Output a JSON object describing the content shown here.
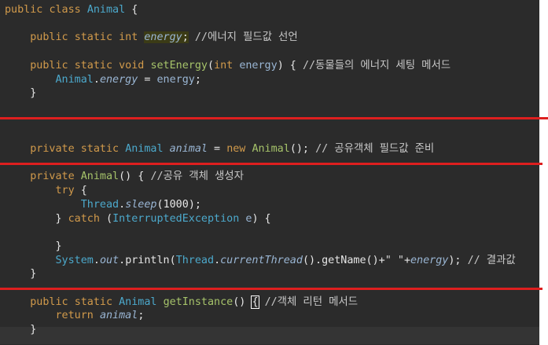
{
  "code_lines": [
    {
      "tokens": [
        {
          "c": "kw",
          "t": "public"
        },
        {
          "c": "pl",
          "t": " "
        },
        {
          "c": "kw",
          "t": "class"
        },
        {
          "c": "pl",
          "t": " "
        },
        {
          "c": "ty",
          "t": "Animal"
        },
        {
          "c": "pl",
          "t": " {"
        }
      ]
    },
    {
      "tokens": []
    },
    {
      "tokens": [
        {
          "c": "pl",
          "t": "    "
        },
        {
          "c": "kw",
          "t": "public"
        },
        {
          "c": "pl",
          "t": " "
        },
        {
          "c": "kw",
          "t": "static"
        },
        {
          "c": "pl",
          "t": " "
        },
        {
          "c": "kw",
          "t": "int"
        },
        {
          "c": "pl",
          "t": " "
        },
        {
          "c": "it hl",
          "t": "energy"
        },
        {
          "c": "pl hl",
          "t": ";"
        },
        {
          "c": "pl",
          "t": " "
        },
        {
          "c": "cm",
          "t": "//에너지 필드값 선언"
        }
      ]
    },
    {
      "tokens": []
    },
    {
      "tokens": [
        {
          "c": "pl",
          "t": "    "
        },
        {
          "c": "kw",
          "t": "public"
        },
        {
          "c": "pl",
          "t": " "
        },
        {
          "c": "kw",
          "t": "static"
        },
        {
          "c": "pl",
          "t": " "
        },
        {
          "c": "kw",
          "t": "void"
        },
        {
          "c": "pl",
          "t": " "
        },
        {
          "c": "fn",
          "t": "setEnergy"
        },
        {
          "c": "pl",
          "t": "("
        },
        {
          "c": "kw",
          "t": "int"
        },
        {
          "c": "pl",
          "t": " "
        },
        {
          "c": "var",
          "t": "energy"
        },
        {
          "c": "pl",
          "t": ") { "
        },
        {
          "c": "cm",
          "t": "//동물들의 에너지 세팅 메서드"
        }
      ]
    },
    {
      "tokens": [
        {
          "c": "pl",
          "t": "        "
        },
        {
          "c": "ty",
          "t": "Animal"
        },
        {
          "c": "pl",
          "t": "."
        },
        {
          "c": "it",
          "t": "energy"
        },
        {
          "c": "pl",
          "t": " = "
        },
        {
          "c": "var",
          "t": "energy"
        },
        {
          "c": "pl",
          "t": ";"
        }
      ]
    },
    {
      "tokens": [
        {
          "c": "pl",
          "t": "    }"
        }
      ]
    },
    {
      "tokens": []
    },
    {
      "tokens": []
    },
    {
      "tokens": []
    },
    {
      "tokens": [
        {
          "c": "pl",
          "t": "    "
        },
        {
          "c": "kw",
          "t": "private"
        },
        {
          "c": "pl",
          "t": " "
        },
        {
          "c": "kw",
          "t": "static"
        },
        {
          "c": "pl",
          "t": " "
        },
        {
          "c": "ty",
          "t": "Animal"
        },
        {
          "c": "pl",
          "t": " "
        },
        {
          "c": "it",
          "t": "animal"
        },
        {
          "c": "pl",
          "t": " = "
        },
        {
          "c": "kw",
          "t": "new"
        },
        {
          "c": "pl",
          "t": " "
        },
        {
          "c": "fn",
          "t": "Animal"
        },
        {
          "c": "pl",
          "t": "(); "
        },
        {
          "c": "cm",
          "t": "// 공유객체 필드값 준비"
        }
      ]
    },
    {
      "tokens": []
    },
    {
      "tokens": [
        {
          "c": "pl",
          "t": "    "
        },
        {
          "c": "kw",
          "t": "private"
        },
        {
          "c": "pl",
          "t": " "
        },
        {
          "c": "fn",
          "t": "Animal"
        },
        {
          "c": "pl",
          "t": "() { "
        },
        {
          "c": "cm",
          "t": "//공유 객체 생성자"
        }
      ]
    },
    {
      "tokens": [
        {
          "c": "pl",
          "t": "        "
        },
        {
          "c": "kw",
          "t": "try"
        },
        {
          "c": "pl",
          "t": " {"
        }
      ]
    },
    {
      "tokens": [
        {
          "c": "pl",
          "t": "            "
        },
        {
          "c": "ty",
          "t": "Thread"
        },
        {
          "c": "pl",
          "t": "."
        },
        {
          "c": "it",
          "t": "sleep"
        },
        {
          "c": "pl",
          "t": "("
        },
        {
          "c": "num",
          "t": "1000"
        },
        {
          "c": "pl",
          "t": ");"
        }
      ]
    },
    {
      "tokens": [
        {
          "c": "pl",
          "t": "        } "
        },
        {
          "c": "kw",
          "t": "catch"
        },
        {
          "c": "pl",
          "t": " ("
        },
        {
          "c": "ty",
          "t": "InterruptedException"
        },
        {
          "c": "pl",
          "t": " "
        },
        {
          "c": "var",
          "t": "e"
        },
        {
          "c": "pl",
          "t": ") {"
        }
      ]
    },
    {
      "tokens": []
    },
    {
      "tokens": [
        {
          "c": "pl",
          "t": "        }"
        }
      ]
    },
    {
      "tokens": [
        {
          "c": "pl",
          "t": "        "
        },
        {
          "c": "ty",
          "t": "System"
        },
        {
          "c": "pl",
          "t": "."
        },
        {
          "c": "it",
          "t": "out"
        },
        {
          "c": "pl",
          "t": "."
        },
        {
          "c": "pl",
          "t": "println("
        },
        {
          "c": "ty",
          "t": "Thread"
        },
        {
          "c": "pl",
          "t": "."
        },
        {
          "c": "it",
          "t": "currentThread"
        },
        {
          "c": "pl",
          "t": "().getName()+"
        },
        {
          "c": "str",
          "t": "\" \""
        },
        {
          "c": "pl",
          "t": "+"
        },
        {
          "c": "it",
          "t": "energy"
        },
        {
          "c": "pl",
          "t": "); "
        },
        {
          "c": "cm",
          "t": "// 결과값"
        }
      ]
    },
    {
      "tokens": [
        {
          "c": "pl",
          "t": "    }"
        }
      ]
    },
    {
      "tokens": []
    },
    {
      "tokens": [
        {
          "c": "pl",
          "t": "    "
        },
        {
          "c": "kw",
          "t": "public"
        },
        {
          "c": "pl",
          "t": " "
        },
        {
          "c": "kw",
          "t": "static"
        },
        {
          "c": "pl",
          "t": " "
        },
        {
          "c": "ty",
          "t": "Animal"
        },
        {
          "c": "pl",
          "t": " "
        },
        {
          "c": "fn",
          "t": "getInstance"
        },
        {
          "c": "pl",
          "t": "() "
        },
        {
          "c": "pl boxed",
          "t": "{"
        },
        {
          "c": "pl",
          "t": " "
        },
        {
          "c": "cm",
          "t": "//객체 리턴 메서드"
        }
      ]
    },
    {
      "tokens": [
        {
          "c": "pl",
          "t": "        "
        },
        {
          "c": "kw",
          "t": "return"
        },
        {
          "c": "pl",
          "t": " "
        },
        {
          "c": "it",
          "t": "animal"
        },
        {
          "c": "pl",
          "t": ";"
        }
      ]
    },
    {
      "tokens": [
        {
          "c": "pl",
          "t": "    }"
        }
      ]
    }
  ]
}
